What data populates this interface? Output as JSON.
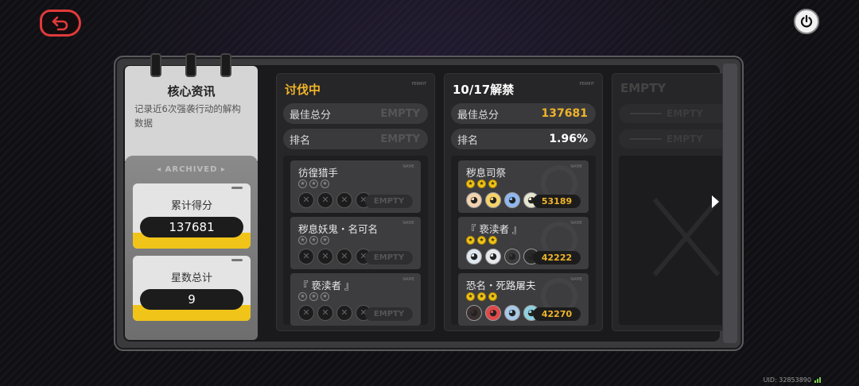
{
  "header": {
    "back_icon": "back-arrow-icon",
    "power_icon": "power-icon",
    "uid_text": "UID: 32853890"
  },
  "notepad": {
    "title": "核心资讯",
    "description": "记录近6次强袭行动的解构数据",
    "archived_label": "ARCHIVED",
    "cards": [
      {
        "label": "累计得分",
        "value": "137681"
      },
      {
        "label": "星数总计",
        "value": "9"
      }
    ]
  },
  "panels": [
    {
      "title": "讨伐中",
      "title_color": "#f0b429",
      "permit": "PERMIT",
      "rows": [
        {
          "label": "最佳总分",
          "value": "EMPTY",
          "empty": true
        },
        {
          "label": "排名",
          "value": "EMPTY",
          "empty": true
        }
      ],
      "enemies": [
        {
          "name": "彷徨猎手",
          "tag": "NAME",
          "stars": [
            false,
            false,
            false
          ],
          "badge": "EMPTY",
          "empty": true
        },
        {
          "name": "秽息妖鬼・名可名",
          "tag": "NAME",
          "stars": [
            false,
            false,
            false
          ],
          "badge": "EMPTY",
          "empty": true
        },
        {
          "name": "『 亵渎者 』",
          "tag": "NAME",
          "stars": [
            false,
            false,
            false
          ],
          "badge": "EMPTY",
          "empty": true
        }
      ]
    },
    {
      "title": "10/17解禁",
      "title_color": "#ffffff",
      "permit": "PERMIT",
      "rows": [
        {
          "label": "最佳总分",
          "value": "137681",
          "empty": false,
          "value_color": "#f0b429"
        },
        {
          "label": "排名",
          "value": "1.96%",
          "empty": false,
          "value_color": "#ffffff"
        }
      ],
      "enemies": [
        {
          "name": "秽息司祭",
          "tag": "NAME",
          "stars": [
            true,
            true,
            true
          ],
          "badge": "53189",
          "empty": false,
          "avatars": [
            "#f2d2b0",
            "#f5d36a",
            "#8fb8f0",
            "#e6e6d0"
          ]
        },
        {
          "name": "『 亵渎者 』",
          "tag": "NAME",
          "stars": [
            true,
            true,
            true
          ],
          "badge": "42222",
          "empty": false,
          "avatars": [
            "#dfe8f0",
            "#e8e8ec",
            "#3a3a3a",
            "#2a2a2a"
          ]
        },
        {
          "name": "恐名・死路屠夫",
          "tag": "NAME",
          "stars": [
            true,
            true,
            true
          ],
          "badge": "42270",
          "empty": false,
          "avatars": [
            "#3a3030",
            "#e04a4a",
            "#a8c8e8",
            "#8fd0e0"
          ]
        }
      ]
    }
  ],
  "empty_panel": {
    "title": "EMPTY",
    "rows": [
      "EMPTY",
      "EMPTY"
    ]
  }
}
